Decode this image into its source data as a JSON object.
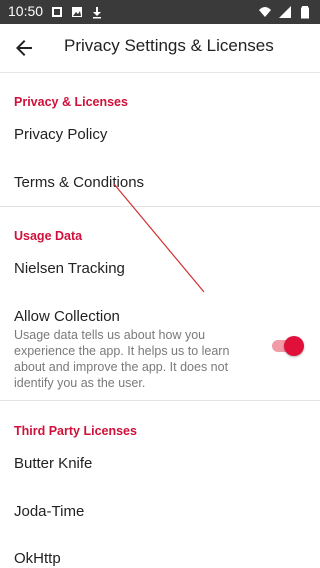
{
  "status_bar": {
    "time": "10:50",
    "left_icons": [
      "notification-icon",
      "image-icon",
      "download-icon"
    ],
    "right_icons": [
      "wifi-icon",
      "signal-icon",
      "battery-icon"
    ]
  },
  "app_bar": {
    "title": "Privacy Settings & Licenses",
    "back_icon": "arrow-back-icon"
  },
  "sections": {
    "privacy": {
      "header": "Privacy & Licenses",
      "items": [
        "Privacy Policy",
        "Terms & Conditions"
      ]
    },
    "usage": {
      "header": "Usage Data",
      "items": [
        "Nielsen Tracking"
      ],
      "allow_collection": {
        "label": "Allow Collection",
        "description": "Usage data tells us about how you experience the app. It helps us to learn about and improve the app. It does not identify you as the user.",
        "enabled": true
      }
    },
    "third_party": {
      "header": "Third Party Licenses",
      "items": [
        "Butter Knife",
        "Joda-Time",
        "OkHttp"
      ]
    }
  },
  "colors": {
    "accent": "#d0103a",
    "status_bar": "#3a3a3a",
    "toggle_thumb": "#e0103a",
    "toggle_track": "#f19aa8",
    "annotation_line": "#d23030"
  }
}
